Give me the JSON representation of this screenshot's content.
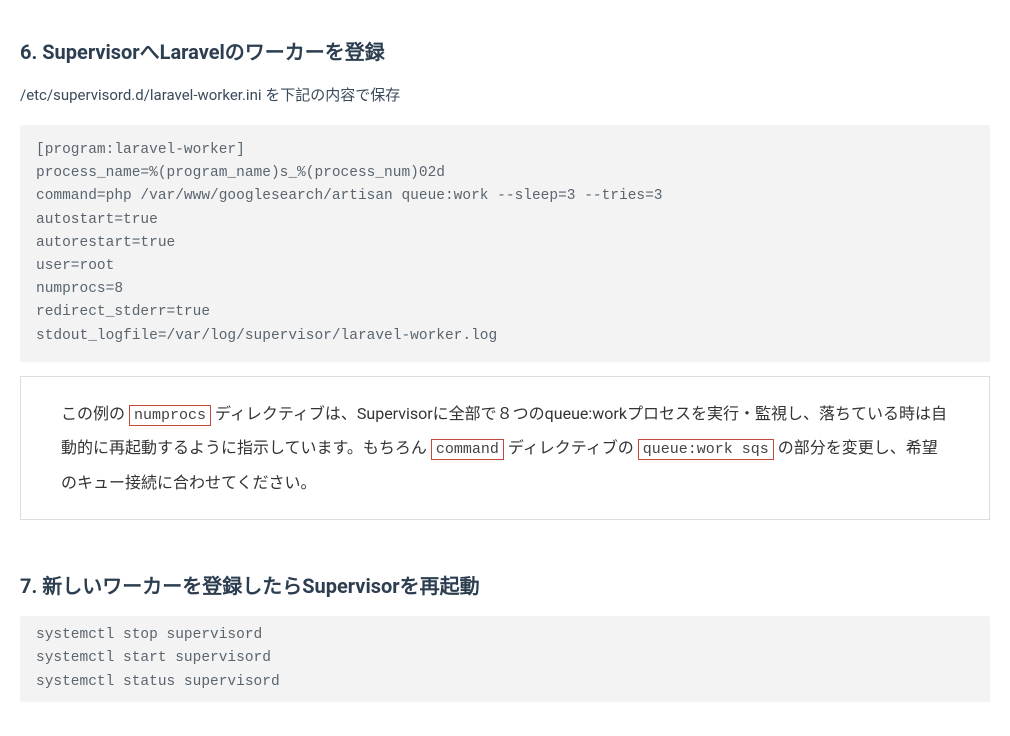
{
  "section6": {
    "heading": "6. SupervisorへLaravelのワーカーを登録",
    "intro": "/etc/supervisord.d/laravel-worker.ini を下記の内容で保存",
    "code": "[program:laravel-worker]\nprocess_name=%(program_name)s_%(process_num)02d\ncommand=php /var/www/googlesearch/artisan queue:work --sleep=3 --tries=3\nautostart=true\nautorestart=true\nuser=root\nnumprocs=8\nredirect_stderr=true\nstdout_logfile=/var/log/supervisor/laravel-worker.log",
    "quote": {
      "pre1": "この例の",
      "code1": "numprocs",
      "mid1": "ディレクティブは、Supervisorに全部で８つのqueue:workプロセスを実行・監視し、落ちている時は自動的に再起動するように指示しています。もちろん",
      "code2": "command",
      "mid2": "ディレクティブの",
      "code3": "queue:work sqs",
      "post": "の部分を変更し、希望のキュー接続に合わせてください。"
    }
  },
  "section7": {
    "heading": "7. 新しいワーカーを登録したらSupervisorを再起動",
    "code": "systemctl stop supervisord\nsystemctl start supervisord\nsystemctl status supervisord"
  }
}
